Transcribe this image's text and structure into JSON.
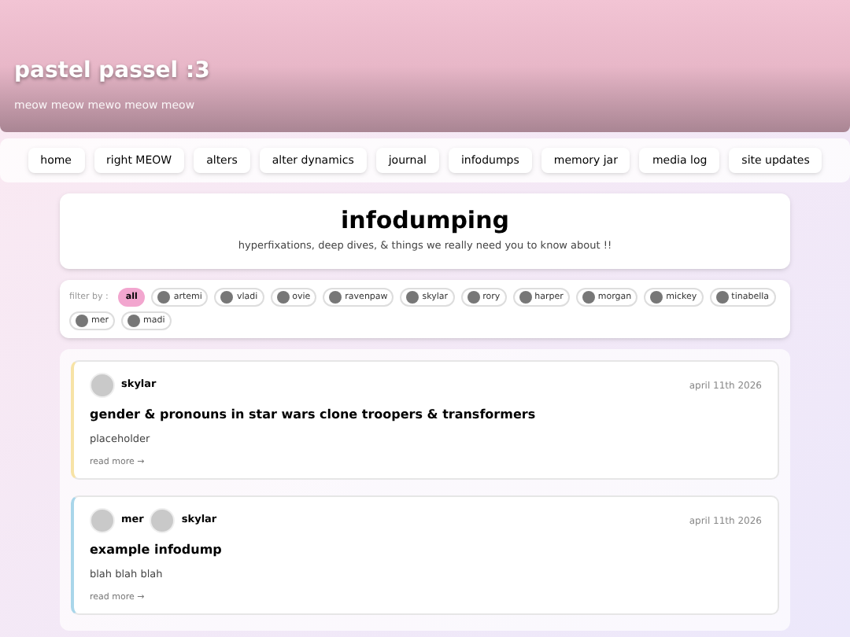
{
  "header": {
    "title": "pastel passel :3",
    "subtitle": "meow meow mewo meow meow"
  },
  "nav": [
    {
      "label": "home"
    },
    {
      "label": "right MEOW"
    },
    {
      "label": "alters"
    },
    {
      "label": "alter dynamics"
    },
    {
      "label": "journal"
    },
    {
      "label": "infodumps"
    },
    {
      "label": "memory jar"
    },
    {
      "label": "media log"
    },
    {
      "label": "site updates"
    }
  ],
  "page": {
    "title": "infodumping",
    "subtitle": "hyperfixations, deep dives, & things we really need you to know about !!"
  },
  "filter": {
    "label": "filter by :",
    "options": [
      {
        "label": "all",
        "selected": true,
        "avatar": false
      },
      {
        "label": "artemi",
        "selected": false,
        "avatar": true
      },
      {
        "label": "vladi",
        "selected": false,
        "avatar": true
      },
      {
        "label": "ovie",
        "selected": false,
        "avatar": true
      },
      {
        "label": "ravenpaw",
        "selected": false,
        "avatar": true
      },
      {
        "label": "skylar",
        "selected": false,
        "avatar": true
      },
      {
        "label": "rory",
        "selected": false,
        "avatar": true
      },
      {
        "label": "harper",
        "selected": false,
        "avatar": true
      },
      {
        "label": "morgan",
        "selected": false,
        "avatar": true
      },
      {
        "label": "mickey",
        "selected": false,
        "avatar": true
      },
      {
        "label": "tinabella",
        "selected": false,
        "avatar": true
      },
      {
        "label": "mer",
        "selected": false,
        "avatar": true
      },
      {
        "label": "madi",
        "selected": false,
        "avatar": true
      }
    ]
  },
  "posts": [
    {
      "color": "#f7e3a6",
      "authors": [
        "skylar"
      ],
      "date": "april 11th 2026",
      "title": "gender & pronouns in star wars clone troopers & transformers",
      "body": "placeholder",
      "link": "read more →"
    },
    {
      "color": "#a9d6ea",
      "authors": [
        "mer",
        "skylar"
      ],
      "date": "april 11th 2026",
      "title": "example infodump",
      "body": "blah blah blah",
      "link": "read more →"
    }
  ]
}
